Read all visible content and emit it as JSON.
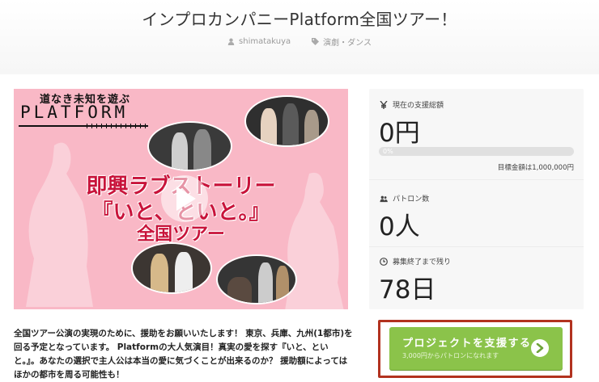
{
  "page": {
    "title": "インプロカンパニーPlatform全国ツアー！",
    "author": "shimatakuya",
    "category": "演劇・ダンス",
    "author_icon": "user-icon",
    "category_icon": "tag-icon"
  },
  "video": {
    "logo_tagline": "道なき未知を遊ぶ",
    "logo_name": "PLATFORM",
    "headline_line1": "即興ラブストーリー",
    "headline_line2": "『いと、といと。』",
    "headline_line3": "全国ツアー",
    "play_icon": "play-icon",
    "background_color": "#f9b8c6",
    "text_color": "#c8133a"
  },
  "stats": {
    "funding_label": "現在の支援総額",
    "funding_icon": "yen-icon",
    "funding_value": "0円",
    "progress_percent": 0,
    "progress_text": "0%",
    "goal_text": "目標金額は1,000,000円",
    "backers_label": "パトロン数",
    "backers_icon": "users-icon",
    "backers_value": "0人",
    "remaining_label": "募集終了まで残り",
    "remaining_icon": "clock-icon",
    "remaining_value": "78日"
  },
  "description": {
    "text": "全国ツアー公演の実現のために、援助をお願いいたします！ 東京、兵庫、九州(1都市)を回る予定となっています。 Platformの大人気演目！真実の愛を探す『いと、といと。』。あなたの選択で主人公は本当の愛に気づくことが出来るのか？ 援助額によってはほかの都市を周る可能性も！"
  },
  "support": {
    "label": "プロジェクトを支援する",
    "sublabel": "3,000円からパトロンになれます",
    "button_color": "#8bc34a",
    "highlight_color": "#b2321f",
    "arrow_icon": "chevron-right-circle-icon"
  }
}
